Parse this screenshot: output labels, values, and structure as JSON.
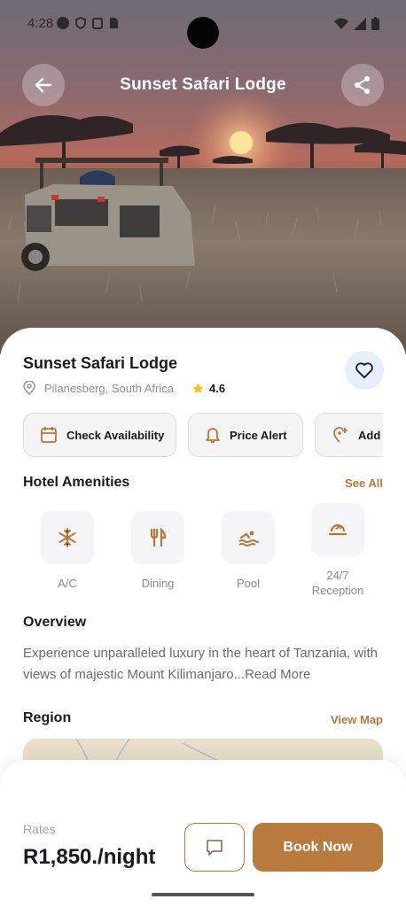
{
  "status_bar": {
    "time": "4:28"
  },
  "header": {
    "title": "Sunset Safari Lodge"
  },
  "hotel": {
    "name": "Sunset Safari Lodge",
    "location": "Pilanesberg, South Africa",
    "rating": "4.6"
  },
  "actions": [
    {
      "label": "Check Availability",
      "icon": "calendar-icon"
    },
    {
      "label": "Price Alert",
      "icon": "bell-icon"
    },
    {
      "label": "Add to",
      "icon": "location-plus-icon"
    }
  ],
  "amenities": {
    "title": "Hotel Amenities",
    "see_all": "See All",
    "items": [
      {
        "label": "A/C",
        "icon": "snowflake-icon"
      },
      {
        "label": "Dining",
        "icon": "fork-knife-icon"
      },
      {
        "label": "Pool",
        "icon": "swimmer-icon"
      },
      {
        "label": "24/7 Reception",
        "icon": "reception-icon"
      }
    ]
  },
  "overview": {
    "title": "Overview",
    "text": "Experience unparalleled luxury in the heart of Tanzania, with views of majestic Mount Kilimanjaro...Read More"
  },
  "region": {
    "title": "Region",
    "view_map": "View Map"
  },
  "booking": {
    "rates_label": "Rates",
    "price": "R1,850./night",
    "book_label": "Book Now"
  },
  "colors": {
    "accent": "#b7773a",
    "favorite_bg": "#e6eefc",
    "star": "#f5c10e"
  }
}
